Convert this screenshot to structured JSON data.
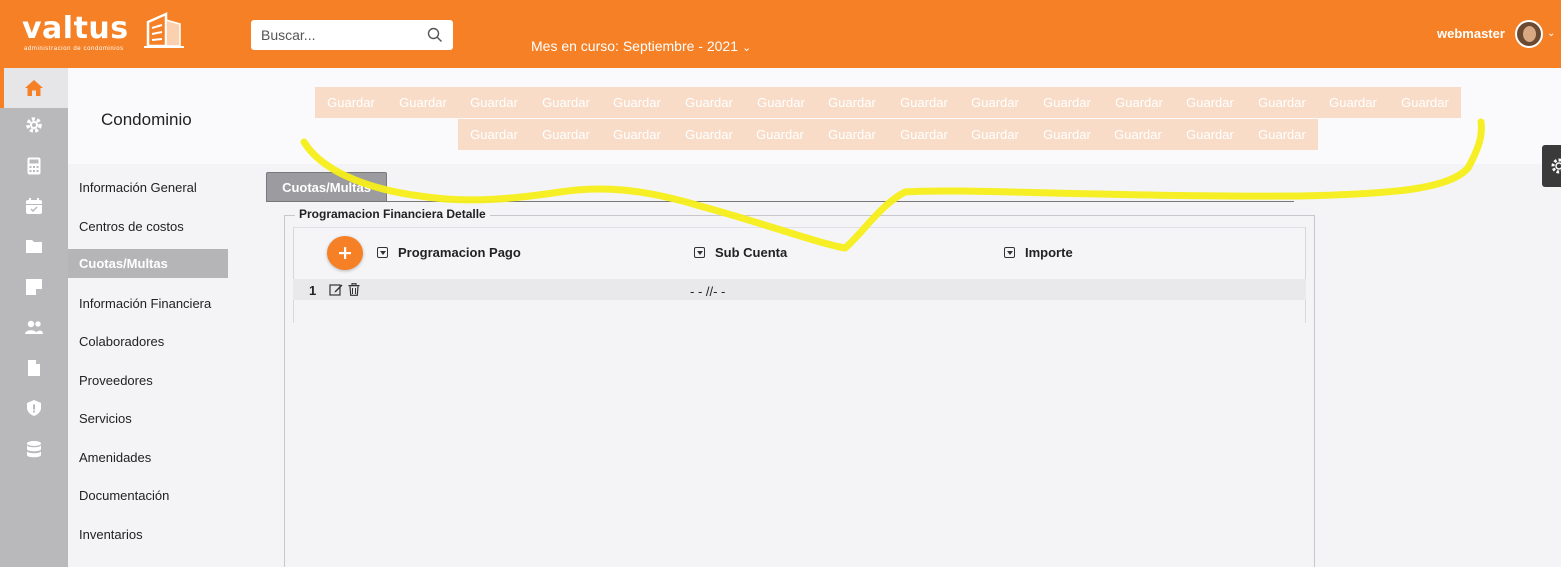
{
  "header": {
    "logo_text": "valtus",
    "logo_subtitle": "administracion de condominios",
    "search_placeholder": "Buscar...",
    "current_month": "Mes en curso: Septiembre - 2021",
    "username": "webmaster"
  },
  "rail": {
    "icons": [
      "home-icon",
      "gear-icon",
      "calculator-icon",
      "calendar-icon",
      "folder-icon",
      "sticky-note-icon",
      "users-icon",
      "file-icon",
      "shield-icon",
      "database-icon"
    ],
    "active_index": 0
  },
  "page": {
    "title": "Condominio",
    "save_label": "Guardar",
    "save_row1_count": 16,
    "save_row2_count": 12
  },
  "side_menu": {
    "items": [
      "Información General",
      "Centros de costos",
      "Cuotas/Multas",
      "Información Financiera",
      "Colaboradores",
      "Proveedores",
      "Servicios",
      "Amenidades",
      "Documentación",
      "Inventarios"
    ],
    "active_index": 2
  },
  "tabs": {
    "active": "Cuotas/Multas"
  },
  "detail": {
    "legend": "Programacion Financiera Detalle",
    "columns": [
      "Programacion Pago",
      "Sub Cuenta",
      "Importe"
    ],
    "rows": [
      {
        "number": "1",
        "programacion_pago": "",
        "sub_cuenta": "- - //- -",
        "importe": ""
      }
    ]
  },
  "colors": {
    "brand": "#f58025",
    "save_button": "#f8dcc8",
    "annotation": "#f5ee1a"
  }
}
